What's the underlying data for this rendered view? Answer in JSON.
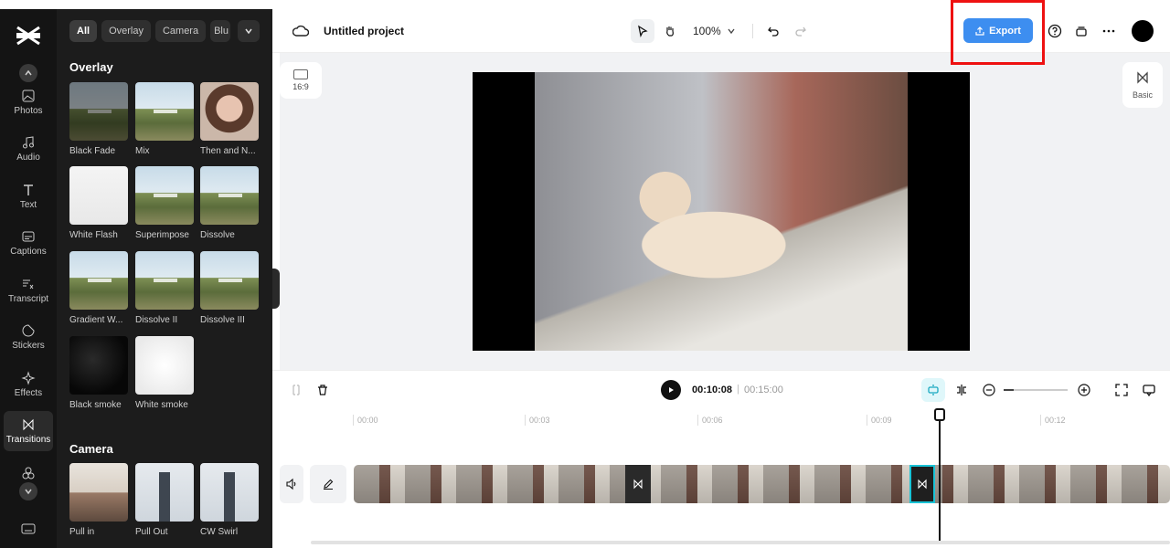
{
  "rail": {
    "items": [
      {
        "label": "Photos",
        "icon": "image-icon"
      },
      {
        "label": "Audio",
        "icon": "music-icon"
      },
      {
        "label": "Text",
        "icon": "text-icon"
      },
      {
        "label": "Captions",
        "icon": "captions-icon"
      },
      {
        "label": "Transcript",
        "icon": "transcript-icon"
      },
      {
        "label": "Stickers",
        "icon": "sticker-icon"
      },
      {
        "label": "Effects",
        "icon": "sparkle-icon"
      },
      {
        "label": "Transitions",
        "icon": "bowtie-icon"
      }
    ],
    "active": "Transitions"
  },
  "panel": {
    "chips": [
      "All",
      "Overlay",
      "Camera",
      "Blu"
    ],
    "sections": [
      {
        "title": "Overlay",
        "tiles": [
          "Black Fade",
          "Mix",
          "Then and N...",
          "White Flash",
          "Superimpose",
          "Dissolve",
          "Gradient W...",
          "Dissolve II",
          "Dissolve III",
          "Black smoke",
          "White smoke"
        ]
      },
      {
        "title": "Camera",
        "tiles": [
          "Pull in",
          "Pull Out",
          "CW Swirl"
        ]
      }
    ]
  },
  "topbar": {
    "project_title": "Untitled project",
    "zoom": "100%",
    "export_label": "Export"
  },
  "canvas": {
    "ratio_label": "16:9",
    "basic_label": "Basic"
  },
  "timeline": {
    "current_time": "00:10:08",
    "separator": "|",
    "total_time": "00:15:00",
    "ticks": [
      "00:00",
      "00:03",
      "00:06",
      "00:09",
      "00:12"
    ],
    "zoom_level": 0.15
  },
  "colors": {
    "accent": "#3d8ef0",
    "highlight": "#ee1111",
    "selection": "#19c3d6"
  }
}
